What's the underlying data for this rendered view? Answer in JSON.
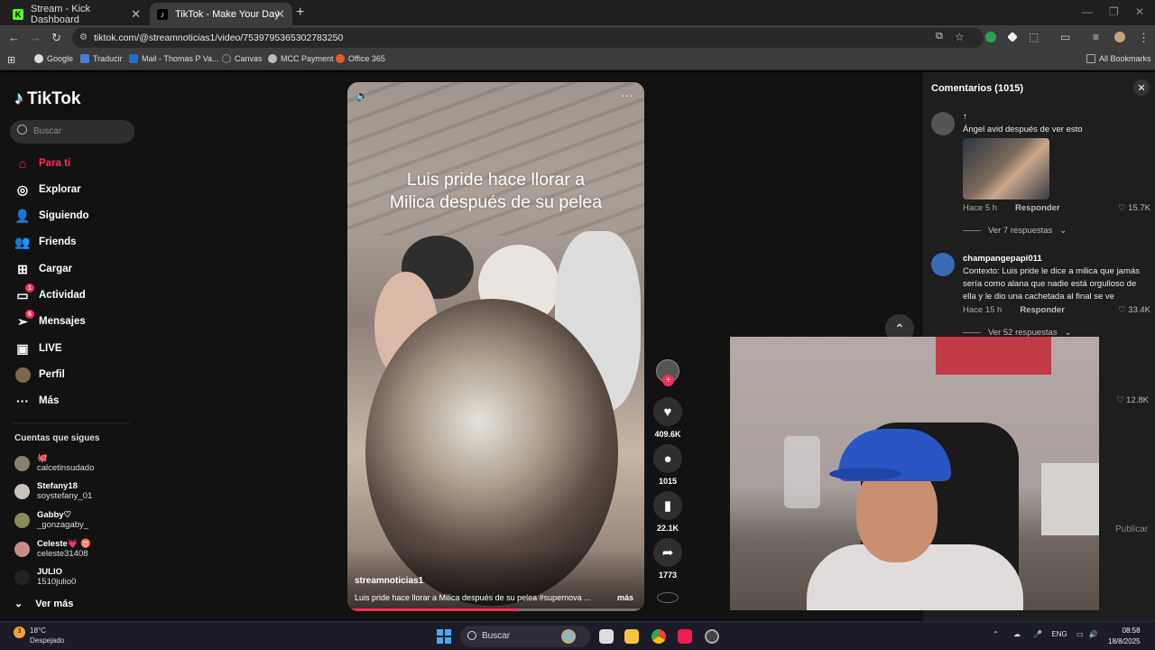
{
  "browser": {
    "tabs": [
      {
        "label": "Stream - Kick Dashboard",
        "favicon": "K",
        "color": "#53fc18"
      },
      {
        "label": "TikTok - Make Your Day",
        "favicon": "♪",
        "color": "#000000"
      }
    ],
    "url": "tiktok.com/@streamnoticias1/video/7539795365302783250",
    "bookmarks": [
      "Google",
      "Traducir",
      "Mail - Thomas P Va...",
      "Canvas",
      "MCC Payment",
      "Office 365"
    ],
    "all_bookmarks": "All Bookmarks"
  },
  "tiktok": {
    "logo": "TikTok",
    "search_placeholder": "Buscar",
    "nav": [
      {
        "label": "Para ti",
        "icon": "home-icon",
        "active": true
      },
      {
        "label": "Explorar",
        "icon": "compass-icon"
      },
      {
        "label": "Siguiendo",
        "icon": "following-icon"
      },
      {
        "label": "Friends",
        "icon": "friends-icon"
      },
      {
        "label": "Cargar",
        "icon": "upload-icon"
      },
      {
        "label": "Actividad",
        "icon": "activity-icon",
        "badge": "1"
      },
      {
        "label": "Mensajes",
        "icon": "messages-icon",
        "badge": "6"
      },
      {
        "label": "LIVE",
        "icon": "live-icon"
      },
      {
        "label": "Perfil",
        "icon": "profile-avatar"
      },
      {
        "label": "Más",
        "icon": "more-icon"
      }
    ],
    "following_title": "Cuentas que sigues",
    "accounts": [
      {
        "name": "🐙",
        "handle": "calcetinsudado"
      },
      {
        "name": "Stefany18",
        "handle": "soystefany_01"
      },
      {
        "name": "Gabby♡",
        "handle": "_gonzagaby_"
      },
      {
        "name": "Celeste💗 ♉",
        "handle": "celeste31408"
      },
      {
        "name": "JULIO",
        "handle": "1510julio0"
      }
    ],
    "see_more": "Ver más"
  },
  "video": {
    "caption_line1": "Luis pride hace llorar  a",
    "caption_line2": "Milica después de su pelea",
    "username": "streamnoticias1",
    "description": "Luis pride hace llorar a Milica después de su pelea #supernova ...",
    "more": "más",
    "progress": 0.57,
    "likes": "409.6K",
    "comments": "1015",
    "saves": "22.1K",
    "shares": "1773"
  },
  "comments_panel": {
    "title": "Comentarios (1015)",
    "items": [
      {
        "user": "↑",
        "text": "Ángel avid después de ver esto",
        "time": "Hace 5 h",
        "reply": "Responder",
        "likes": "15.7K",
        "replies": "Ver 7 respuestas"
      },
      {
        "user": "champangepapi011",
        "text": "Contexto: Luis pride le dice a milica que jamás sería como alana que nadie está orgulloso de ella y le dio una cachetada al final se ve",
        "time": "Hace 15 h",
        "reply": "Responder",
        "likes": "33.4K",
        "replies": "Ver 52 respuestas"
      }
    ],
    "hidden_like": "12.8K",
    "publish": "Publicar"
  },
  "taskbar": {
    "temp": "18°C",
    "weather": "Despejado",
    "search": "Buscar",
    "lang": "ENG",
    "time": "08:58",
    "date": "18/8/2025"
  },
  "colors": {
    "accent": "#fe2c55",
    "bg": "#121212"
  }
}
